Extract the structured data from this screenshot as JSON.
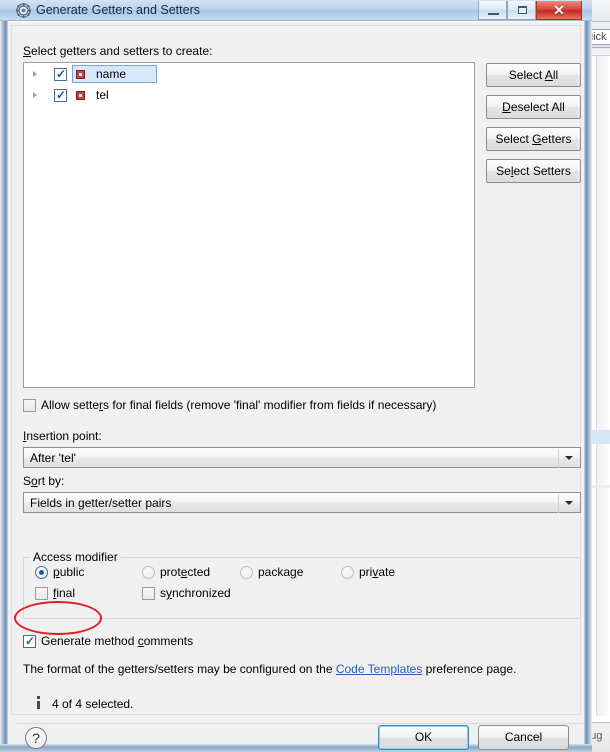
{
  "background_app": {
    "quick_access_partial": "uick",
    "status_partial": "oug"
  },
  "window": {
    "title": "Generate Getters and Setters",
    "icon": "eclipse-gear-icon",
    "minimize_label": "Minimize",
    "maximize_label": "Maximize",
    "close_label": "Close"
  },
  "main": {
    "instruction_label": "Select getters and setters to create:",
    "tree": {
      "items": [
        {
          "label": "name",
          "checked": true,
          "selected": true,
          "expandable": true,
          "icon": "private-field-icon"
        },
        {
          "label": "tel",
          "checked": true,
          "selected": false,
          "expandable": true,
          "icon": "private-field-icon"
        }
      ]
    },
    "side_buttons": [
      {
        "pre": "Select ",
        "mnemonic": "A",
        "post": "ll"
      },
      {
        "pre": "",
        "mnemonic": "D",
        "post": "eselect All"
      },
      {
        "pre": "Select ",
        "mnemonic": "G",
        "post": "etters"
      },
      {
        "pre": "Se",
        "mnemonic": "l",
        "post": "ect Setters"
      }
    ],
    "allow_final": {
      "checked": false,
      "pre": "Allow sette",
      "mnemonic": "r",
      "post": "s for final fields (remove 'final' modifier from fields if necessary)"
    },
    "insertion_point": {
      "label_pre": "",
      "label_mnemonic": "I",
      "label_post": "nsertion point:",
      "value": "After 'tel'"
    },
    "sort_by": {
      "label_pre": "S",
      "label_mnemonic": "o",
      "label_post": "rt by:",
      "value": "Fields in getter/setter pairs"
    },
    "access_modifier": {
      "legend": "Access modifier",
      "radios": [
        {
          "pre": "",
          "mnemonic": "p",
          "post": "ublic",
          "checked": true,
          "enabled": true
        },
        {
          "pre": "prot",
          "mnemonic": "e",
          "post": "cted",
          "checked": false,
          "enabled": false
        },
        {
          "pre": "packa",
          "mnemonic": "g",
          "post": "e",
          "checked": false,
          "enabled": false
        },
        {
          "pre": "pri",
          "mnemonic": "v",
          "post": "ate",
          "checked": false,
          "enabled": false
        }
      ],
      "checkboxes": [
        {
          "pre": "",
          "mnemonic": "f",
          "post": "inal",
          "checked": false
        },
        {
          "pre": "s",
          "mnemonic": "y",
          "post": "nchronized",
          "checked": false
        }
      ]
    },
    "generate_comments": {
      "checked": true,
      "pre": "Generate method ",
      "mnemonic": "c",
      "post": "omments"
    },
    "templates_note": {
      "before": "The format of the getters/setters may be configured on the ",
      "link": "Code Templates",
      "after": " preference page."
    },
    "status": {
      "icon": "info-icon",
      "text": "4 of 4 selected."
    }
  },
  "footer": {
    "help_glyph": "?",
    "ok_label": "OK",
    "cancel_label": "Cancel"
  },
  "annotation": {
    "shape": "red-ellipse",
    "color": "#e02020",
    "targets": "generate-method-comments-checkbox"
  }
}
